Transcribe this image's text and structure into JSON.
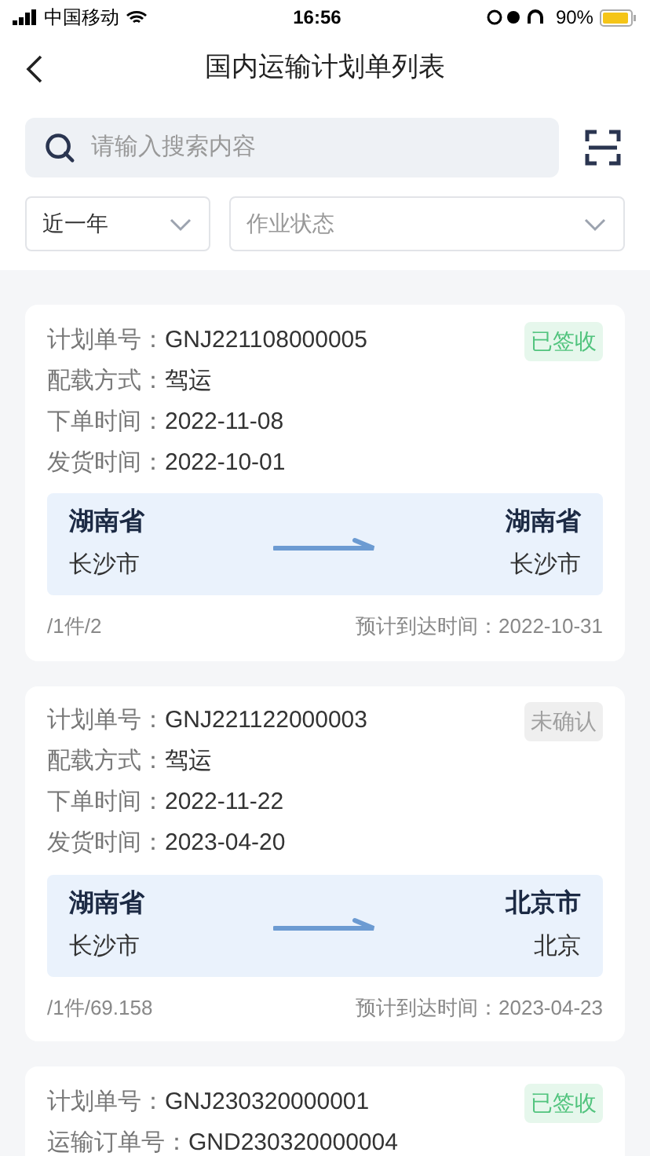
{
  "status_bar": {
    "carrier": "中国移动",
    "time": "16:56",
    "battery": "90%"
  },
  "header": {
    "title": "国内运输计划单列表"
  },
  "search": {
    "placeholder": "请输入搜索内容"
  },
  "filters": [
    {
      "value": "近一年",
      "is_placeholder": false
    },
    {
      "value": "作业状态",
      "is_placeholder": true
    }
  ],
  "orders": [
    {
      "fields": [
        {
          "label": "计划单号：",
          "value": "GNJ221108000005"
        },
        {
          "label": "配载方式：",
          "value": "驾运"
        },
        {
          "label": "下单时间：",
          "value": "2022-11-08"
        },
        {
          "label": "发货时间：",
          "value": "2022-10-01"
        }
      ],
      "status": {
        "kind": "signed",
        "text": "已签收"
      },
      "route": {
        "from_province": "湖南省",
        "from_city": "长沙市",
        "to_province": "湖南省",
        "to_city": "长沙市"
      },
      "quantity": "/1件/2",
      "eta": "预计到达时间：2022-10-31"
    },
    {
      "fields": [
        {
          "label": "计划单号：",
          "value": "GNJ221122000003"
        },
        {
          "label": "配载方式：",
          "value": "驾运"
        },
        {
          "label": "下单时间：",
          "value": "2022-11-22"
        },
        {
          "label": "发货时间：",
          "value": "2023-04-20"
        }
      ],
      "status": {
        "kind": "pending",
        "text": "未确认"
      },
      "route": {
        "from_province": "湖南省",
        "from_city": "长沙市",
        "to_province": "北京市",
        "to_city": "北京"
      },
      "quantity": "/1件/69.158",
      "eta": "预计到达时间：2023-04-23"
    },
    {
      "fields": [
        {
          "label": "计划单号：",
          "value": "GNJ230320000001"
        },
        {
          "label": "运输订单号：",
          "value": "GND230320000004"
        }
      ],
      "status": {
        "kind": "signed",
        "text": "已签收"
      }
    }
  ]
}
